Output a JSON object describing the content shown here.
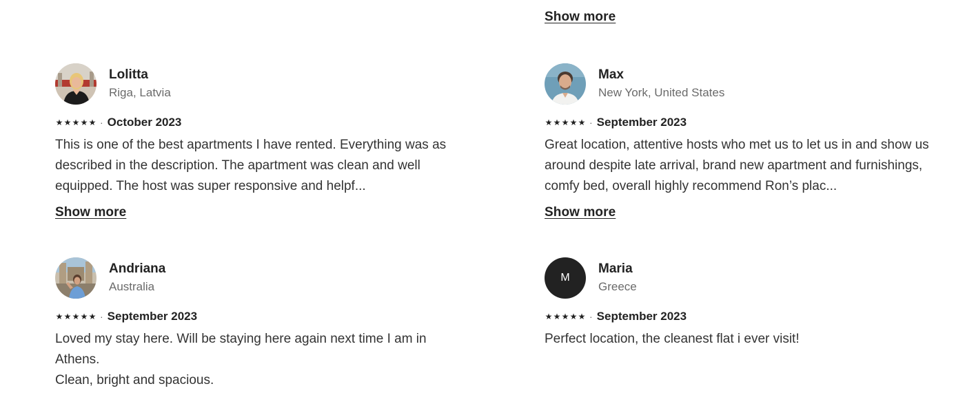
{
  "top_show_more": "Show more",
  "reviews": [
    {
      "name": "Lolitta",
      "location": "Riga, Latvia",
      "stars": [
        "★",
        "★",
        "★",
        "★",
        "★"
      ],
      "separator": "·",
      "date": "October 2023",
      "text": "This is one of the best apartments I have rented. Everything was as described in the description. The apartment was clean and well equipped. The host was super responsive and helpf...",
      "show_more": "Show more"
    },
    {
      "name": "Max",
      "location": "New York, United States",
      "stars": [
        "★",
        "★",
        "★",
        "★",
        "★"
      ],
      "separator": "·",
      "date": "September 2023",
      "text": "Great location, attentive hosts who met us to let us in and show us around despite late arrival, brand new apartment and furnishings, comfy bed, overall highly recommend Ron’s plac...",
      "show_more": "Show more"
    },
    {
      "name": "Andriana",
      "location": "Australia",
      "stars": [
        "★",
        "★",
        "★",
        "★",
        "★"
      ],
      "separator": "·",
      "date": "September 2023",
      "text": "Loved my stay here. Will be staying here again next time I am in Athens.\nClean, bright and spacious."
    },
    {
      "name": "Maria",
      "location": "Greece",
      "avatar_initial": "M",
      "stars": [
        "★",
        "★",
        "★",
        "★",
        "★"
      ],
      "separator": "·",
      "date": "September 2023",
      "text": "Perfect location, the cleanest flat i ever visit!"
    }
  ],
  "colors": {
    "text_primary": "#222222",
    "text_secondary": "#6a6a6a",
    "avatar_initial_bg": "#222222"
  }
}
